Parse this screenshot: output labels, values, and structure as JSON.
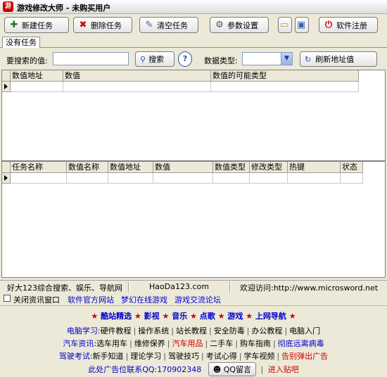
{
  "window": {
    "title": "游戏修改大师 - 未购买用户"
  },
  "toolbar": {
    "new_task": "新建任务",
    "delete_task": "删除任务",
    "clear_tasks": "清空任务",
    "settings": "参数设置",
    "register": "软件注册"
  },
  "tabs": [
    "没有任务"
  ],
  "search": {
    "value_label": "要搜索的值:",
    "value": "",
    "search_button": "搜索",
    "help_button": "?",
    "type_label": "数据类型:",
    "type_value": "",
    "refresh_button": "刷新地址值"
  },
  "results_table": {
    "columns": [
      "数值地址",
      "数值",
      "数值的可能类型"
    ]
  },
  "task_table": {
    "columns": [
      "任务名称",
      "数值名称",
      "数值地址",
      "数值",
      "数值类型",
      "修改类型",
      "热键",
      "状态"
    ]
  },
  "statusbar": {
    "promo": "好大123综合搜索、娱乐、导航网",
    "domain": "HaoDa123.com",
    "welcome": "欢迎访问:http://www.microsword.net"
  },
  "links": {
    "close_info": "关闭资讯窗口",
    "official_site": "软件官方网站",
    "online_games": "梦幻在线游戏",
    "forum": "游戏交流论坛"
  },
  "ad_panel": {
    "nav": [
      "酷站精选",
      "影视",
      "音乐",
      "点歌",
      "游戏",
      "上网导航"
    ],
    "star": "★",
    "rows": [
      {
        "head": "电脑学习",
        "items": [
          "硬件教程",
          "操作系统",
          "站长教程",
          "安全防毒",
          "办公教程",
          "电脑入门"
        ]
      },
      {
        "head": "汽车资讯",
        "items": [
          "选车用车",
          "维修保养",
          "汽车用品",
          "二手车",
          "购车指南",
          "彻底远离病毒"
        ]
      },
      {
        "head": "驾驶考试",
        "items": [
          "新手知道",
          "理论学习",
          "驾驶技巧",
          "考试心得",
          "学车视频",
          "告别弹出广告"
        ]
      }
    ],
    "contact": "此处广告位联系QQ:170902348",
    "qq_button": "QQ留言",
    "enter": "进入贴吧"
  }
}
